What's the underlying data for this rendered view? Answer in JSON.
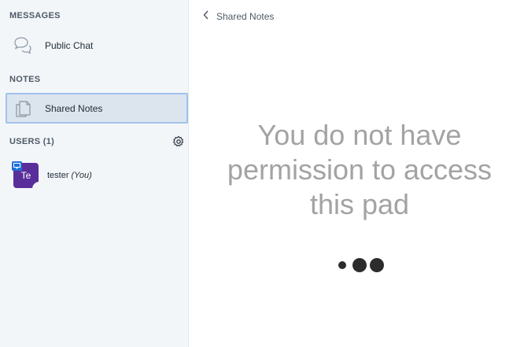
{
  "sidebar": {
    "messages_title": "MESSAGES",
    "public_chat": {
      "label": "Public Chat",
      "icon": "chat-bubbles-icon"
    },
    "notes_title": "NOTES",
    "shared_notes": {
      "label": "Shared Notes",
      "icon": "notes-pages-icon"
    },
    "users_title": "USERS (1)",
    "settings_icon": "gear-icon",
    "users": [
      {
        "avatar_initials": "Te",
        "name": "tester",
        "you_label": "(You)",
        "avatar_color": "#5a2e9a",
        "presenter_badge_color": "#1e6fd8"
      }
    ]
  },
  "panel": {
    "back_icon": "chevron-left-icon",
    "title": "Shared Notes",
    "message": "You do not have permission to access this pad",
    "loader_icon": "loading-dots-icon"
  },
  "colors": {
    "sidebar_bg": "#f3f6f9",
    "active_item_bg": "#dce4ed",
    "active_item_border": "#9fc3ec",
    "message_text": "#a3a3a3"
  }
}
